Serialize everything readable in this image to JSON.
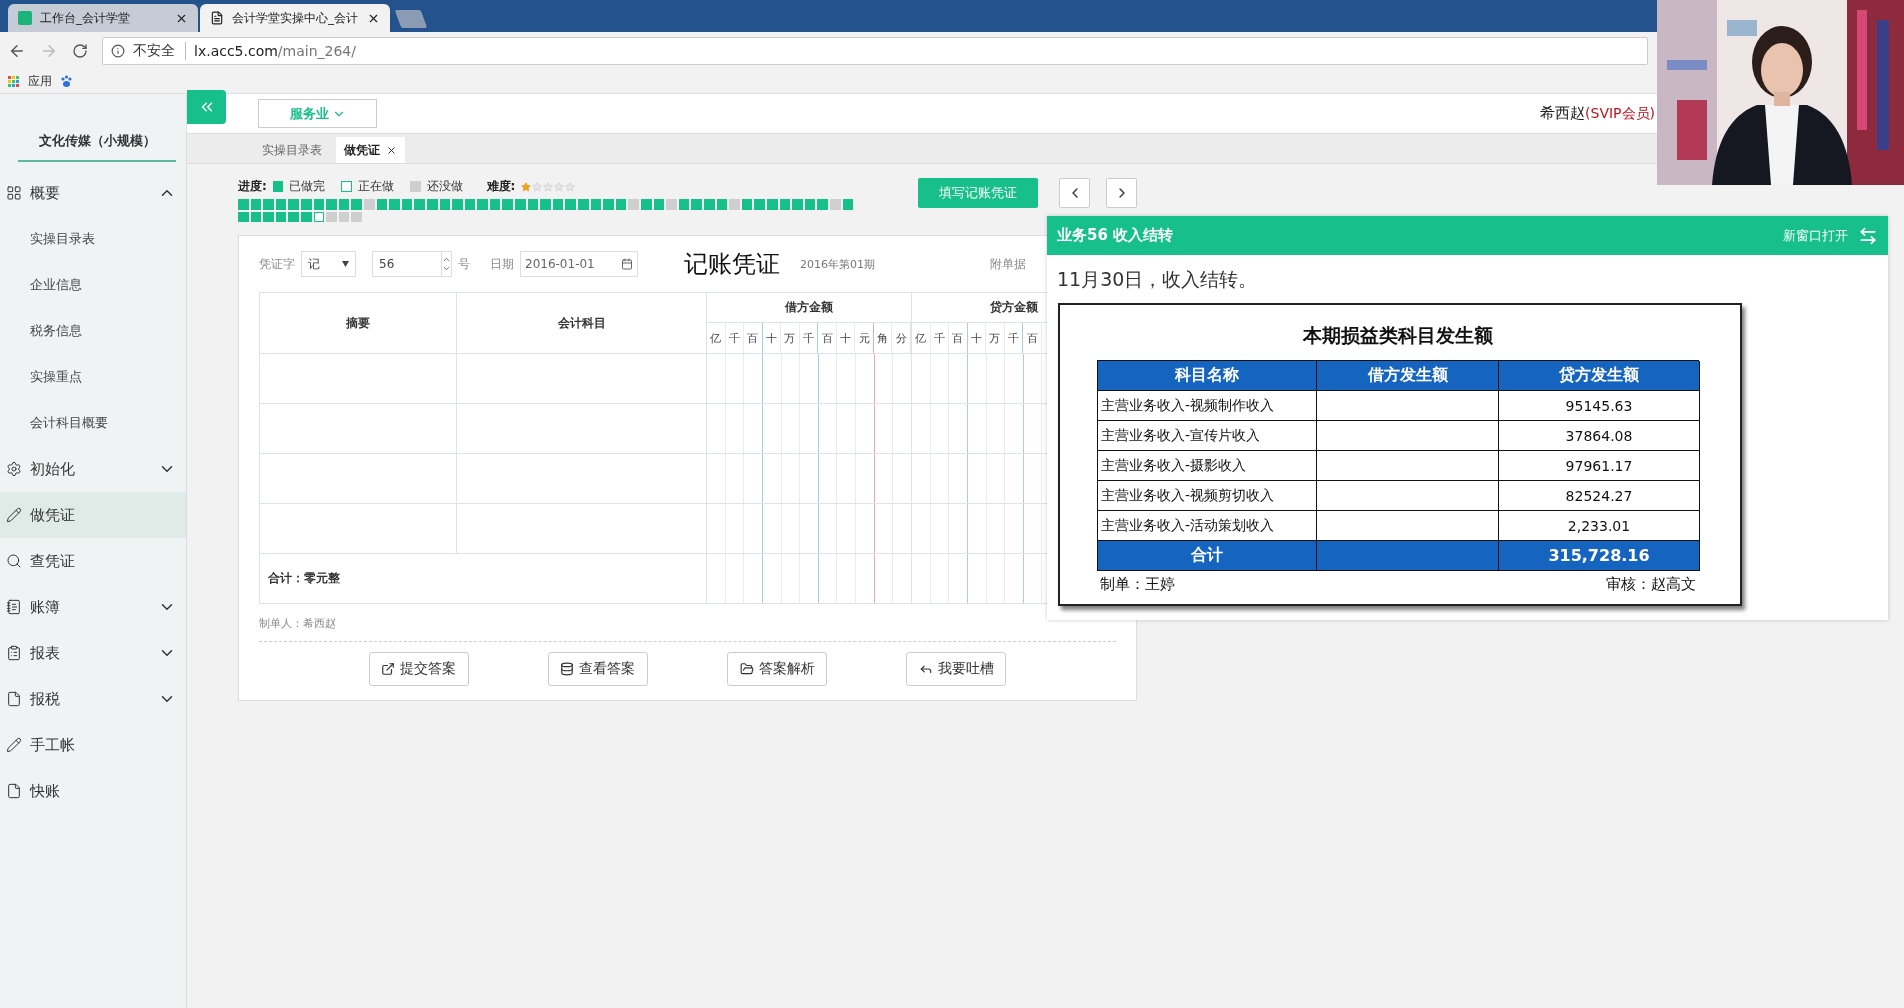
{
  "browser": {
    "tabs": [
      {
        "title": "工作台_会计学堂",
        "selected": false
      },
      {
        "title": "会计学堂实操中心_会计",
        "selected": true
      }
    ],
    "security": "不安全",
    "url_host": "lx.acc5.com",
    "url_path": "/main_264/",
    "bookmarks": [
      "应用"
    ]
  },
  "header": {
    "industry": "服务业",
    "user": "希西赵",
    "membership": "(SVIP会员)"
  },
  "sidebar": {
    "company": "文化传媒（小规模）",
    "items": [
      {
        "kind": "group",
        "label": "概要",
        "expanded": true,
        "selected": false,
        "children": [
          {
            "label": "实操目录表",
            "selected": false
          },
          {
            "label": "企业信息",
            "selected": false
          },
          {
            "label": "税务信息",
            "selected": false
          },
          {
            "label": "实操重点",
            "selected": false
          },
          {
            "label": "会计科目概要",
            "selected": false
          }
        ]
      },
      {
        "kind": "group",
        "label": "初始化",
        "expanded": false,
        "selected": false
      },
      {
        "kind": "link",
        "label": "做凭证",
        "selected": true
      },
      {
        "kind": "link",
        "label": "查凭证",
        "selected": false
      },
      {
        "kind": "group",
        "label": "账簿",
        "expanded": false,
        "selected": false
      },
      {
        "kind": "group",
        "label": "报表",
        "expanded": false,
        "selected": false
      },
      {
        "kind": "group",
        "label": "报税",
        "expanded": false,
        "selected": false
      },
      {
        "kind": "link",
        "label": "手工帐",
        "selected": false
      },
      {
        "kind": "link",
        "label": "快账",
        "selected": false
      }
    ]
  },
  "tabs": [
    {
      "label": "实操目录表",
      "selected": false,
      "closable": false
    },
    {
      "label": "做凭证",
      "selected": true,
      "closable": true
    }
  ],
  "progress": {
    "label": "进度:",
    "legend": [
      {
        "label": "已做完",
        "kind": "done"
      },
      {
        "label": "正在做",
        "kind": "current"
      },
      {
        "label": "还没做",
        "kind": "todo"
      }
    ],
    "difficulty_label": "难度:",
    "stars": 1,
    "cells": [
      {
        "kind": "done"
      },
      {
        "kind": "done"
      },
      {
        "kind": "done"
      },
      {
        "kind": "done"
      },
      {
        "kind": "done"
      },
      {
        "kind": "done"
      },
      {
        "kind": "done"
      },
      {
        "kind": "done"
      },
      {
        "kind": "done"
      },
      {
        "kind": "done"
      },
      {
        "kind": "todo"
      },
      {
        "kind": "done"
      },
      {
        "kind": "done"
      },
      {
        "kind": "done"
      },
      {
        "kind": "done"
      },
      {
        "kind": "done"
      },
      {
        "kind": "done"
      },
      {
        "kind": "done"
      },
      {
        "kind": "done"
      },
      {
        "kind": "done"
      },
      {
        "kind": "done"
      },
      {
        "kind": "done"
      },
      {
        "kind": "done"
      },
      {
        "kind": "done"
      },
      {
        "kind": "done"
      },
      {
        "kind": "done"
      },
      {
        "kind": "done"
      },
      {
        "kind": "done"
      },
      {
        "kind": "done"
      },
      {
        "kind": "done"
      },
      {
        "kind": "done"
      },
      {
        "kind": "todo"
      },
      {
        "kind": "done"
      },
      {
        "kind": "done"
      },
      {
        "kind": "todo"
      },
      {
        "kind": "done"
      },
      {
        "kind": "done"
      },
      {
        "kind": "done"
      },
      {
        "kind": "done"
      },
      {
        "kind": "todo"
      },
      {
        "kind": "done"
      },
      {
        "kind": "done"
      },
      {
        "kind": "done"
      },
      {
        "kind": "done"
      },
      {
        "kind": "done"
      },
      {
        "kind": "done"
      },
      {
        "kind": "done"
      },
      {
        "kind": "todo"
      },
      {
        "kind": "done"
      },
      {
        "kind": "done"
      },
      {
        "kind": "done"
      },
      {
        "kind": "done"
      },
      {
        "kind": "done"
      },
      {
        "kind": "done"
      },
      {
        "kind": "done"
      },
      {
        "kind": "current"
      },
      {
        "kind": "todo"
      },
      {
        "kind": "todo"
      },
      {
        "kind": "todo"
      }
    ]
  },
  "fill_button": "填写记账凭证",
  "voucher": {
    "word_label": "凭证字",
    "word": "记",
    "number": "56",
    "number_suffix": "号",
    "date_label": "日期",
    "date": "2016-01-01",
    "title": "记账凭证",
    "period": "2016年第01期",
    "attachments_label": "附单据",
    "columns": {
      "summary": "摘要",
      "account": "会计科目",
      "debit": "借方金额",
      "credit": "贷方金额"
    },
    "debit_digits": [
      "亿",
      "千",
      "百",
      "十",
      "万",
      "千",
      "百",
      "十",
      "元",
      "角",
      "分"
    ],
    "credit_digits": [
      "亿",
      "千",
      "百",
      "十",
      "万",
      "千",
      "百"
    ],
    "total": "合计：零元整",
    "maker": "制单人：希西赵",
    "buttons": [
      {
        "label": "提交答案"
      },
      {
        "label": "查看答案"
      },
      {
        "label": "答案解析"
      },
      {
        "label": "我要吐槽"
      }
    ]
  },
  "task_panel": {
    "title": "业务56 收入结转",
    "open_new": "新窗口打开",
    "description": "11月30日，收入结转。",
    "sheet": {
      "title": "本期损益类科目发生额",
      "columns": [
        "科目名称",
        "借方发生额",
        "贷方发生额"
      ],
      "rows": [
        {
          "name": "主营业务收入-视频制作收入",
          "credit": "95145.63"
        },
        {
          "name": "主营业务收入-宣传片收入",
          "credit": "37864.08"
        },
        {
          "name": "主营业务收入-摄影收入",
          "credit": "97961.17"
        },
        {
          "name": "主营业务收入-视频剪切收入",
          "credit": "82524.27"
        },
        {
          "name": "主营业务收入-活动策划收入",
          "credit": "2,233.01"
        }
      ],
      "total": {
        "label": "合计",
        "credit": "315,728.16"
      },
      "maker": "制单：王婷",
      "reviewer": "审核：赵高文"
    }
  }
}
